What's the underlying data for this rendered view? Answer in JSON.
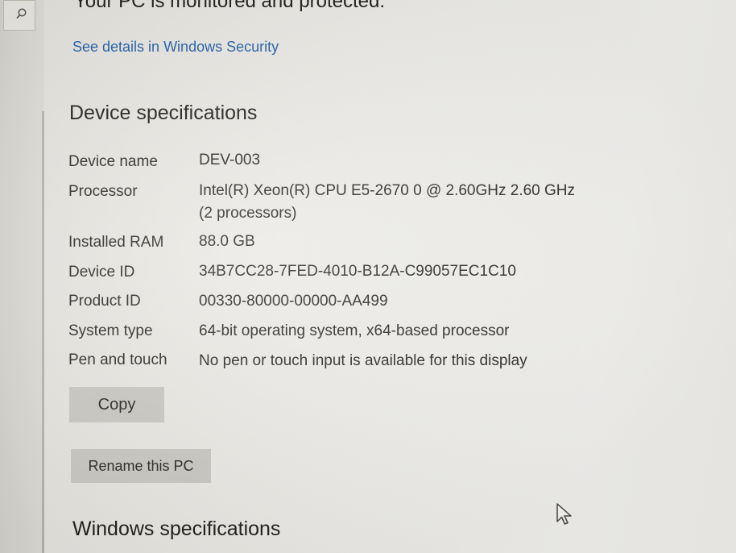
{
  "status": {
    "message": "Your PC is monitored and protected.",
    "link": "See details in Windows Security"
  },
  "device_specifications": {
    "title": "Device specifications",
    "rows": [
      {
        "label": "Device name",
        "value": "DEV-003"
      },
      {
        "label": "Processor",
        "value": "Intel(R) Xeon(R) CPU E5-2670 0 @ 2.60GHz 2.60 GHz (2 processors)"
      },
      {
        "label": "Installed RAM",
        "value": "88.0 GB"
      },
      {
        "label": "Device ID",
        "value": "34B7CC28-7FED-4010-B12A-C99057EC1C10"
      },
      {
        "label": "Product ID",
        "value": "00330-80000-00000-AA499"
      },
      {
        "label": "System type",
        "value": "64-bit operating system, x64-based processor"
      },
      {
        "label": "Pen and touch",
        "value": "No pen or touch input is available for this display"
      }
    ],
    "copy_button": "Copy",
    "rename_button": "Rename this PC"
  },
  "windows_specifications": {
    "title": "Windows specifications"
  },
  "icons": {
    "search": "search-icon",
    "cursor": "mouse-pointer-icon"
  },
  "colors": {
    "link": "#1f5fa8",
    "button": "#cac8c2"
  }
}
